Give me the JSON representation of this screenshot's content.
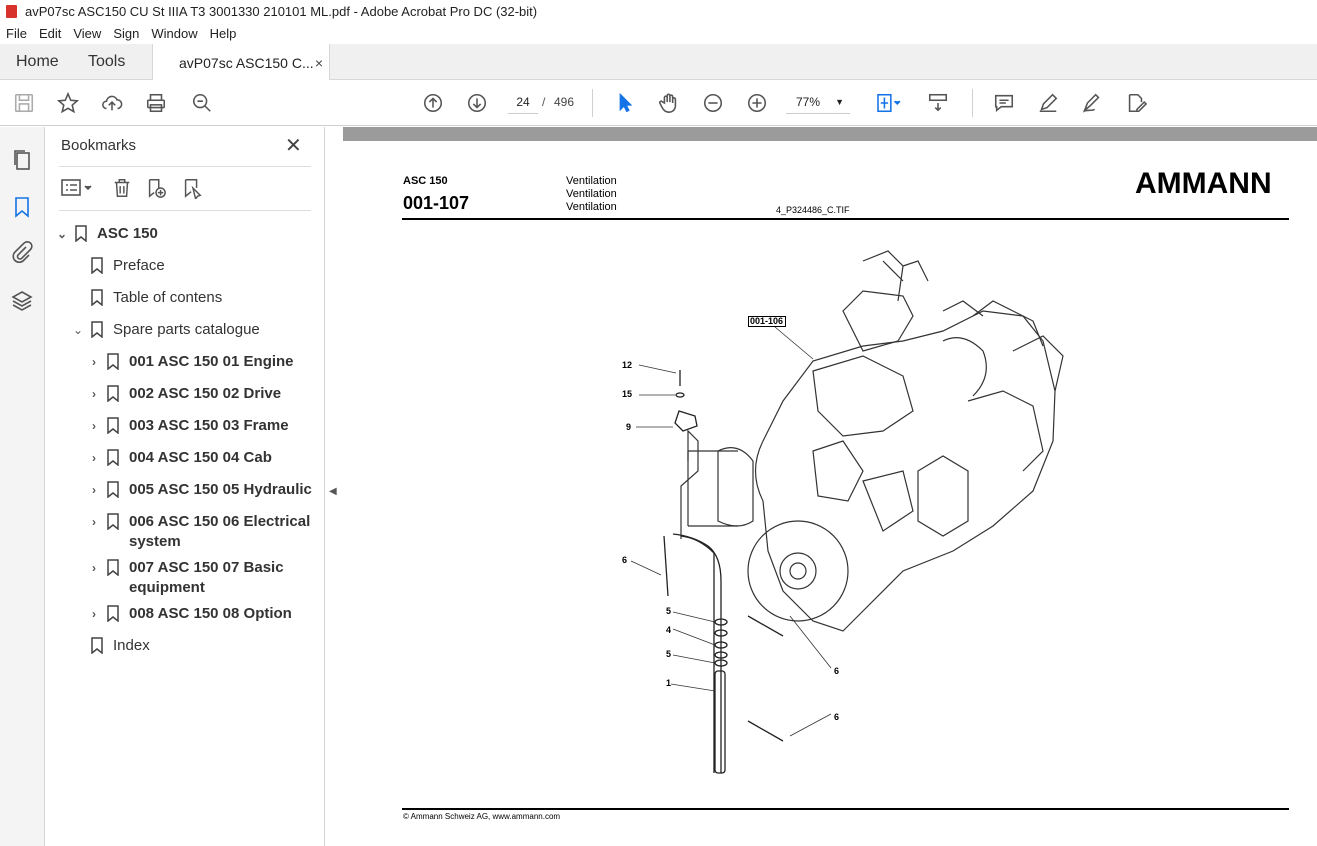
{
  "window": {
    "title": "avP07sc ASC150 CU St IIIA T3 3001330 210101 ML.pdf - Adobe Acrobat Pro DC (32-bit)"
  },
  "menu": [
    "File",
    "Edit",
    "View",
    "Sign",
    "Window",
    "Help"
  ],
  "tabs": {
    "home": "Home",
    "tools": "Tools",
    "document": "avP07sc ASC150 C...",
    "close": "×"
  },
  "toolbar": {
    "page_current": "24",
    "page_sep": "/",
    "page_total": "496",
    "zoom": "77%"
  },
  "bookmarks": {
    "title": "Bookmarks",
    "close": "✕",
    "items": [
      {
        "label": "ASC 150",
        "level": 0,
        "expanded": true,
        "bold": true
      },
      {
        "label": "Preface",
        "level": 1
      },
      {
        "label": "Table of contens",
        "level": 1
      },
      {
        "label": "Spare parts catalogue",
        "level": 1,
        "expanded": true
      },
      {
        "label": "001 ASC 150 01 Engine",
        "level": 2,
        "bold": true
      },
      {
        "label": "002 ASC 150 02 Drive",
        "level": 2,
        "bold": true
      },
      {
        "label": "003 ASC 150 03 Frame",
        "level": 2,
        "bold": true
      },
      {
        "label": "004 ASC 150 04 Cab",
        "level": 2,
        "bold": true
      },
      {
        "label": "005 ASC 150 05 Hydraulic",
        "level": 2,
        "bold": true
      },
      {
        "label": "006 ASC 150 06 Electrical",
        "label2": "system",
        "level": 2,
        "bold": true
      },
      {
        "label": "007 ASC 150 07 Basic",
        "label2": "equipment",
        "level": 2,
        "bold": true
      },
      {
        "label": "008 ASC 150 08 Option",
        "level": 2,
        "bold": true
      },
      {
        "label": "Index",
        "level": 1
      }
    ]
  },
  "document": {
    "model": "ASC 150",
    "code": "001-107",
    "section_lines": [
      "Ventilation",
      "Ventilation",
      "Ventilation"
    ],
    "image_file": "4_P324486_C.TIF",
    "brand": "AMMANN",
    "ref_label": "001-106",
    "callouts": [
      "12",
      "15",
      "9",
      "6",
      "5",
      "4",
      "5",
      "1",
      "6",
      "6"
    ],
    "footer": "© Ammann Schweiz AG, www.ammann.com"
  }
}
